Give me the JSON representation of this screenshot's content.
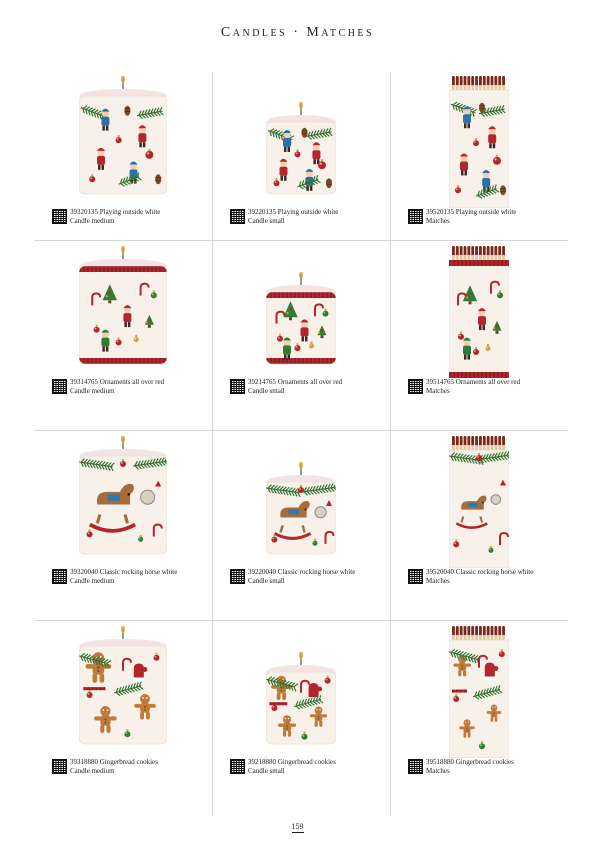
{
  "header": {
    "title": "Candles · Matches"
  },
  "rows": [
    {
      "theme": "playing",
      "items": [
        {
          "code": "39320135 Playing outside white",
          "type": "Candle medium"
        },
        {
          "code": "39220135 Playing outside white",
          "type": "Candle small"
        },
        {
          "code": "39520135 Playing outside white",
          "type": "Matches"
        }
      ]
    },
    {
      "theme": "ornaments",
      "items": [
        {
          "code": "39314765 Ornaments all over red",
          "type": "Candle medium"
        },
        {
          "code": "39214765 Ornaments all over red",
          "type": "Candle small"
        },
        {
          "code": "39514765 Ornaments all over red",
          "type": "Matches"
        }
      ]
    },
    {
      "theme": "horse",
      "items": [
        {
          "code": "39320040 Classic rocking horse white",
          "type": "Candle medium"
        },
        {
          "code": "39220040 Classic rocking horse white",
          "type": "Candle small"
        },
        {
          "code": "39520040 Classic rocking horse white",
          "type": "Matches"
        }
      ]
    },
    {
      "theme": "gingerbread",
      "items": [
        {
          "code": "39318880 Gingerbread cookies",
          "type": "Candle medium"
        },
        {
          "code": "39218880 Gingerbread cookies",
          "type": "Candle small"
        },
        {
          "code": "39518880 Gingerbread cookies",
          "type": "Matches"
        }
      ]
    }
  ],
  "footer": {
    "page_number": "159"
  },
  "colors": {
    "red": "#b3262e",
    "green": "#2e7d32",
    "brown": "#a86b3c",
    "cream": "#f7f1ea",
    "gold": "#d4a23a"
  }
}
